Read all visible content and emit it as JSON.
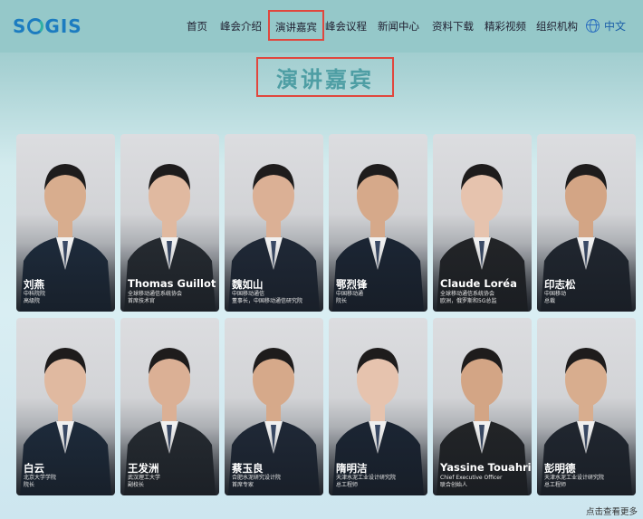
{
  "header": {
    "logo_text_left": "S",
    "logo_text_right": "GIS",
    "nav": [
      {
        "label": "首页",
        "active": false
      },
      {
        "label": "峰会介绍",
        "active": false
      },
      {
        "label": "演讲嘉宾",
        "active": true
      },
      {
        "label": "峰会议程",
        "active": false
      },
      {
        "label": "新闻中心",
        "active": false
      },
      {
        "label": "资料下载",
        "active": false
      },
      {
        "label": "精彩视频",
        "active": false
      },
      {
        "label": "组织机构",
        "active": false
      }
    ],
    "language": "中文"
  },
  "page_title": "演讲嘉宾",
  "speakers": [
    {
      "name": "刘燕",
      "line1": "中科院院",
      "line2": "高级院"
    },
    {
      "name": "Thomas Guillot",
      "line1": "全球移动通信系统协会",
      "line2": "首席技术官"
    },
    {
      "name": "魏如山",
      "line1": "中国移动通信",
      "line2": "董事长，中国移动通信研究院"
    },
    {
      "name": "鄂烈锋",
      "line1": "中国移动通",
      "line2": "院长"
    },
    {
      "name": "Claude Loréa",
      "line1": "全球移动通信系统协会",
      "line2": "欧洲，俄罗斯和5G总监"
    },
    {
      "name": "印志松",
      "line1": "中国移动",
      "line2": "总裁"
    },
    {
      "name": "白云",
      "line1": "北京大学学院",
      "line2": "院长"
    },
    {
      "name": "王发洲",
      "line1": "武汉理工大学",
      "line2": "副校长"
    },
    {
      "name": "蔡玉良",
      "line1": "合肥水泥研究设计院",
      "line2": "首席专家"
    },
    {
      "name": "隋明洁",
      "line1": "天津水泥工业设计研究院",
      "line2": "总工程师"
    },
    {
      "name": "Yassine Touahri",
      "line1": "Chief Executive Officer",
      "line2": "联合创始人"
    },
    {
      "name": "彭明德",
      "line1": "天津水泥工业设计研究院",
      "line2": "总工程师"
    }
  ],
  "more_link": "点击查看更多",
  "colors": {
    "header_bg": "#95c8c9",
    "highlight_border": "#e0473e",
    "title_color": "#4e9ea4",
    "logo_blue": "#1c7cc0"
  }
}
